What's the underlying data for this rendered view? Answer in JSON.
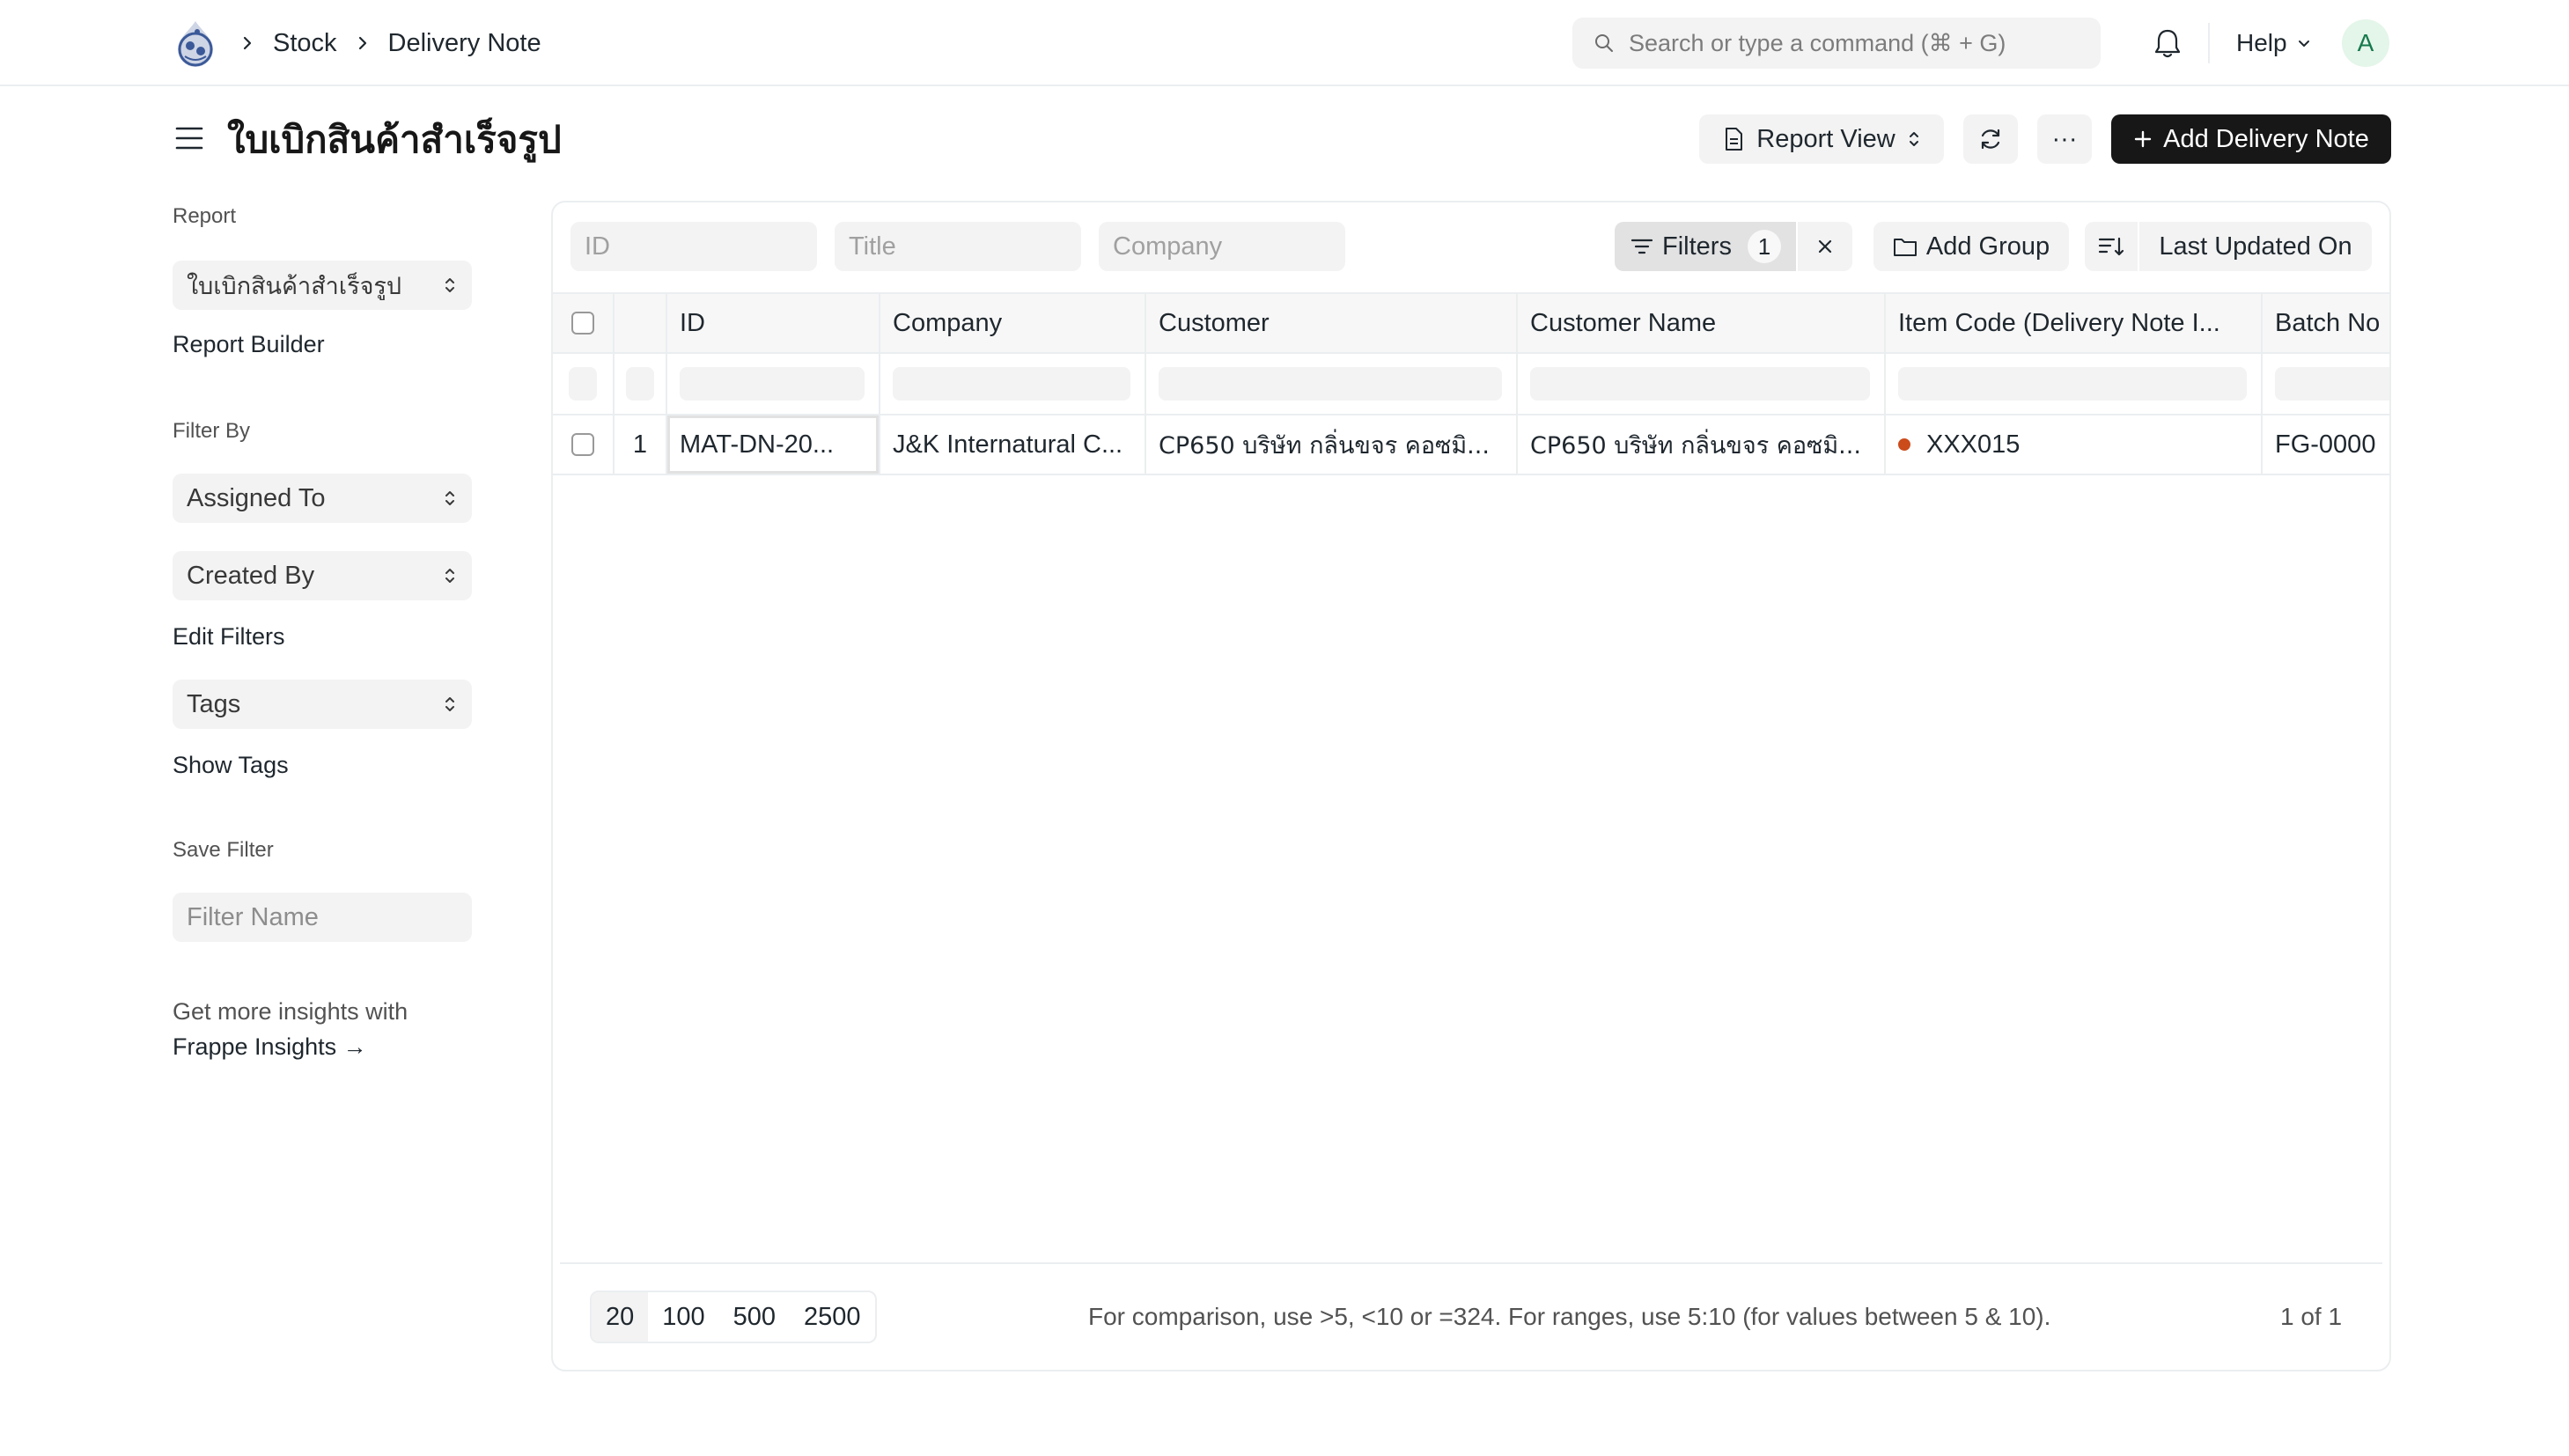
{
  "navbar": {
    "breadcrumbs": [
      "Stock",
      "Delivery Note"
    ],
    "search_placeholder": "Search or type a command (⌘ + G)",
    "help_label": "Help",
    "avatar_initial": "A"
  },
  "page": {
    "title": "ใบเบิกสินค้าสำเร็จรูป",
    "view_label": "Report View",
    "more_label": "···",
    "add_button": "Add Delivery Note"
  },
  "sidebar": {
    "report_label": "Report",
    "report_select": "ใบเบิกสินค้าสำเร็จรูป",
    "report_builder": "Report Builder",
    "filter_by_label": "Filter By",
    "assigned_to": "Assigned To",
    "created_by": "Created By",
    "edit_filters": "Edit Filters",
    "tags": "Tags",
    "show_tags": "Show Tags",
    "save_filter_label": "Save Filter",
    "filter_name_placeholder": "Filter Name",
    "insights_text": "Get more insights with",
    "insights_link": "Frappe Insights →"
  },
  "filters": {
    "id_placeholder": "ID",
    "title_placeholder": "Title",
    "company_placeholder": "Company",
    "filters_label": "Filters",
    "filters_count": "1",
    "add_group": "Add Group",
    "sort_field": "Last Updated On"
  },
  "table": {
    "columns": [
      "ID",
      "Company",
      "Customer",
      "Customer Name",
      "Item Code (Delivery Note I...",
      "Batch No"
    ],
    "rows": [
      {
        "index": "1",
        "id": "MAT-DN-20...",
        "company": "J&K Internatural C...",
        "customer": "CP650 บริษัท กลิ่นขจร คอซมิ...",
        "customer_name": "CP650 บริษัท กลิ่นขจร คอซมิ...",
        "item_code": "XXX015",
        "batch_no": "FG-0000"
      }
    ]
  },
  "footer": {
    "page_sizes": [
      "20",
      "100",
      "500",
      "2500"
    ],
    "hint": "For comparison, use >5, <10 or =324. For ranges, use 5:10 (for values between 5 & 10).",
    "count": "1 of 1"
  },
  "colors": {
    "primary": "#171717",
    "status_dot": "#cb4b1b",
    "avatar_bg": "#e4f5e9",
    "avatar_fg": "#16794c"
  }
}
